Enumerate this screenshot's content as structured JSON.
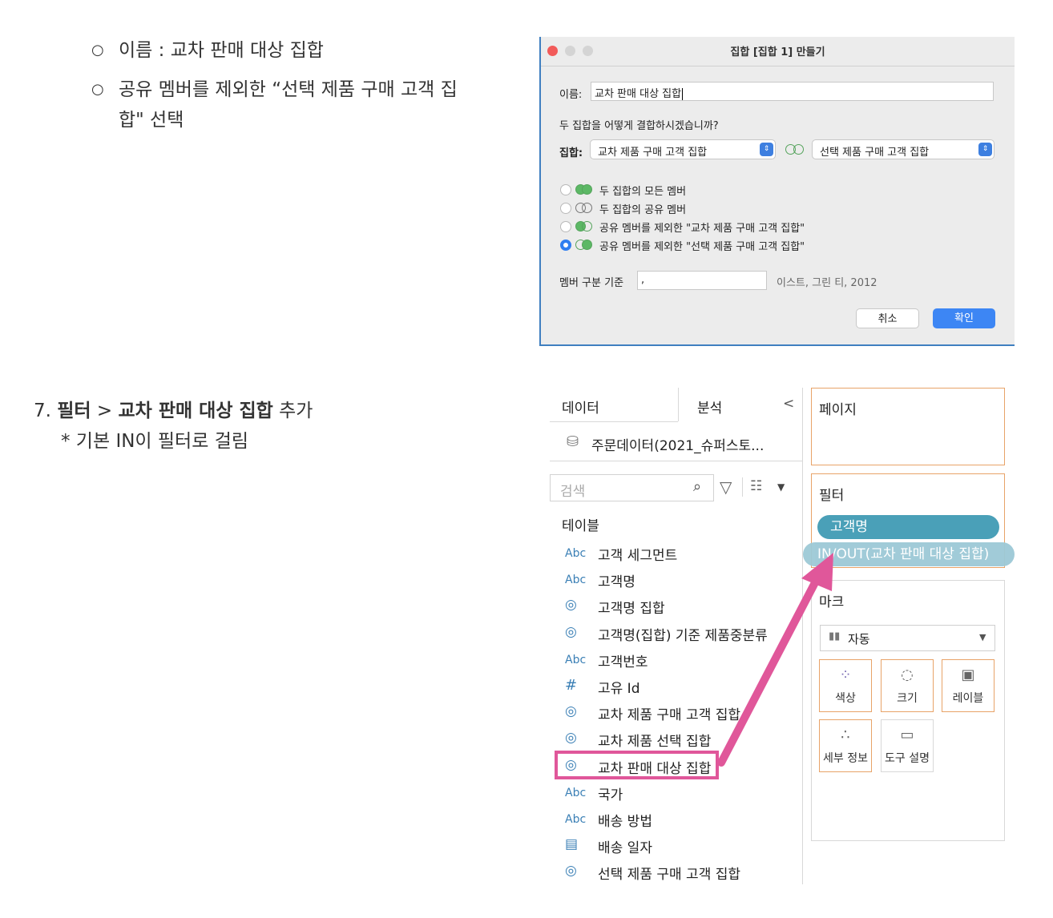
{
  "notes": {
    "bullet1": "이름 : 교차 판매 대상 집합",
    "bullet2_line1": "공유 멤버를 제외한 “선택 제품 구매 고객 집",
    "bullet2_line2": "합\" 선택",
    "step_number": "7.",
    "step_bold1": "필터",
    "step_sep": " > ",
    "step_bold2": "교차 판매 대상 집합",
    "step_tail": " 추가",
    "step_sub": "* 기본 IN이 필터로 걸림"
  },
  "dialog": {
    "title": "집합 [집합 1] 만들기",
    "name_label": "이름:",
    "name_value": "교차 판매 대상 집합",
    "question": "두 집합을 어떻게 결합하시겠습니까?",
    "sets_label": "집합:",
    "set_left": "교차 제품 구매 고객 집합",
    "set_right": "선택 제품 구매 고객 집합",
    "options": [
      "두 집합의 모든 멤버",
      "두 집합의 공유 멤버",
      "공유 멤버를 제외한 \"교차 제품 구매 고객 집합\"",
      "공유 멤버를 제외한 \"선택 제품 구매 고객 집합\""
    ],
    "selected_option": 3,
    "separator_label": "멤버 구분 기준",
    "separator_value": ",",
    "separator_example": "이스트, 그린 티, 2012",
    "cancel": "취소",
    "ok": "확인"
  },
  "tableau": {
    "tab_data": "데이터",
    "tab_analysis": "분석",
    "collapse": "<",
    "datasource": "주문데이터(2021_슈퍼스토...",
    "search_placeholder": "검색",
    "tables_header": "테이블",
    "fields": [
      {
        "icon": "Abc",
        "name": "고객 세그먼트"
      },
      {
        "icon": "Abc",
        "name": "고객명"
      },
      {
        "icon": "set",
        "name": "고객명 집합"
      },
      {
        "icon": "set",
        "name": "고객명(집합) 기준 제품중분류"
      },
      {
        "icon": "Abc",
        "name": "고객번호"
      },
      {
        "icon": "#",
        "name": "고유 Id"
      },
      {
        "icon": "set",
        "name": "교차 제품 구매 고객 집합"
      },
      {
        "icon": "set",
        "name": "교차 제품 선택 집합"
      },
      {
        "icon": "set",
        "name": "교차 판매 대상 집합"
      },
      {
        "icon": "Abc",
        "name": "국가"
      },
      {
        "icon": "Abc",
        "name": "배송 방법"
      },
      {
        "icon": "date",
        "name": "배송 일자"
      },
      {
        "icon": "set",
        "name": "선택 제품 구매 고객 집합"
      }
    ],
    "highlighted_field": 8,
    "pages_shelf": "페이지",
    "filters_shelf": "필터",
    "filter_pills": [
      "고객명",
      "IN/OUT(교차 판매 대상 집합)"
    ],
    "marks_shelf": "마크",
    "marks_type": "자동",
    "mark_buttons": [
      "색상",
      "크기",
      "레이블",
      "세부 정보",
      "도구 설명"
    ]
  },
  "colors": {
    "accent_blue": "#2f7ef0",
    "pill_teal": "#4aa0b8",
    "highlight_pink": "#e0579a",
    "shelf_orange": "#e8a368"
  }
}
